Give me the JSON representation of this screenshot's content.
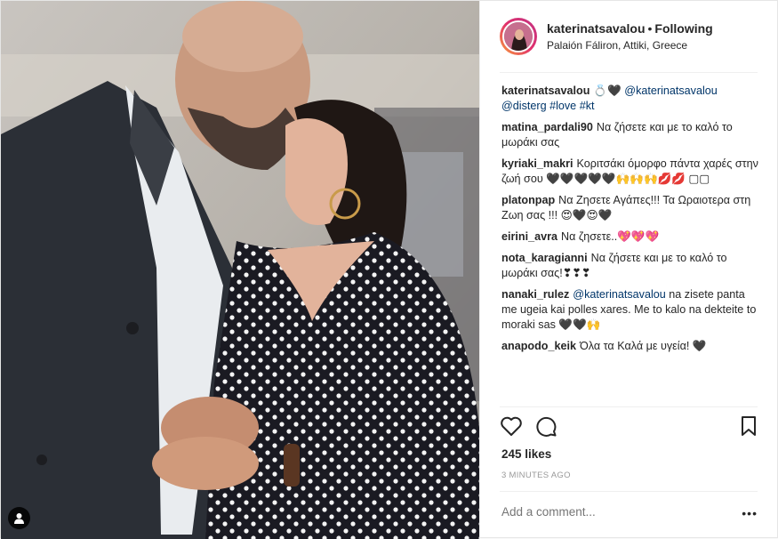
{
  "post": {
    "username": "katerinatsavalou",
    "follow_separator": "•",
    "follow_status": "Following",
    "location": "Palaión Fáliron, Attiki, Greece"
  },
  "caption": {
    "user": "katerinatsavalou",
    "emoji": "💍🖤",
    "mention": "@katerinatsavalou",
    "tail": "@disterg #love #kt"
  },
  "comments": [
    {
      "user": "matina_pardali90",
      "text": "Να ζήσετε και με το καλό το μωράκι σας"
    },
    {
      "user": "kyriaki_makri",
      "text": "Κοριτσάκι όμορφο πάντα χαρές στην ζωή σου 🖤🖤🖤🖤🖤🙌🙌🙌💋💋 ▢▢"
    },
    {
      "user": "platonpap",
      "text": "Να Ζησετε Αγάπες!!! Τα Ωραιοτερα στη Ζωη σας !!! 😍🖤😍🖤"
    },
    {
      "user": "eirini_avra",
      "text": "Να ζησετε..💖💖💖"
    },
    {
      "user": "nota_karagianni",
      "text": "Να ζήσετε και με το καλό το μωράκι σας!❣❣❣"
    },
    {
      "user": "nanaki_rulez",
      "mention": "@katerinatsavalou",
      "text": " na zisete panta me ugeia kai polles xares. Me to kalo na dekteite to moraki sas 🖤🖤🙌"
    },
    {
      "user": "anapodo_keik",
      "text": "Όλα τα Καλά με υγεία! 🖤"
    }
  ],
  "likes": "245 likes",
  "time_ago": "3 MINUTES AGO",
  "add_comment_placeholder": "Add a comment...",
  "more_label": "•••",
  "icons": [
    "heart-icon",
    "comment-icon",
    "bookmark-icon",
    "user-tag-icon"
  ]
}
